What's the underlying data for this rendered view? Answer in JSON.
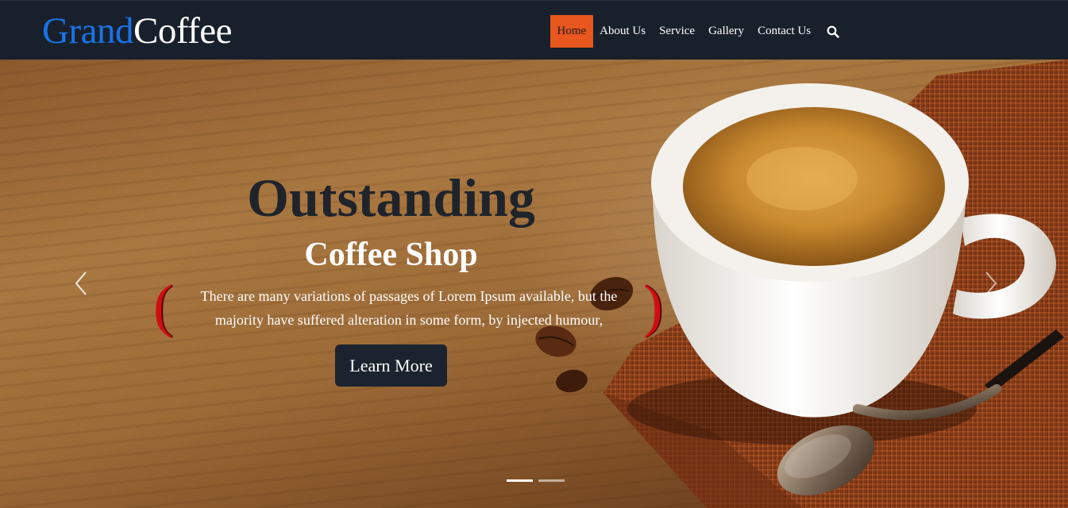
{
  "brand": {
    "part1": "Grand",
    "part2": "Coffee"
  },
  "nav": {
    "items": [
      {
        "label": "Home",
        "active": true
      },
      {
        "label": "About Us",
        "active": false
      },
      {
        "label": "Service",
        "active": false
      },
      {
        "label": "Gallery",
        "active": false
      },
      {
        "label": "Contact Us",
        "active": false
      }
    ],
    "search_icon": "search-icon"
  },
  "hero": {
    "title": "Outstanding",
    "subtitle": "Coffee Shop",
    "text_line1": "There are many variations of passages of Lorem Ipsum available, but the",
    "text_line2": "majority have suffered alteration in some form, by injected humour,",
    "button_label": "Learn More",
    "prev_icon": "chevron-left-icon",
    "next_icon": "chevron-right-icon",
    "slide_count": 2,
    "active_slide": 1
  },
  "colors": {
    "brand_blue": "#1a73e8",
    "accent_orange": "#e8571e",
    "navbar_bg": "#18202b",
    "button_bg": "#1b232e",
    "paren_red": "#cf1010"
  }
}
